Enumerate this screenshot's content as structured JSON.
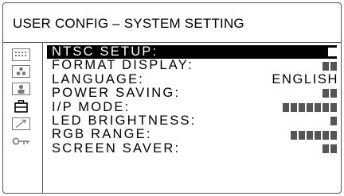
{
  "title": "USER CONFIG – SYSTEM SETTING",
  "sidebar": {
    "icons": [
      {
        "name": "dots-grid-icon"
      },
      {
        "name": "color-palette-icon"
      },
      {
        "name": "user-profile-icon"
      },
      {
        "name": "toolbox-icon",
        "active": true
      },
      {
        "name": "arrow-up-right-icon"
      },
      {
        "name": "key-icon"
      }
    ]
  },
  "menu": {
    "items": [
      {
        "label": "NTSC SETUP:",
        "value_type": "blocks",
        "blocks": 1,
        "selected": true
      },
      {
        "label": "FORMAT DISPLAY:",
        "value_type": "blocks",
        "blocks": 2
      },
      {
        "label": "LANGUAGE:",
        "value_type": "text",
        "value": "ENGLISH"
      },
      {
        "label": "POWER SAVING:",
        "value_type": "blocks",
        "blocks": 2
      },
      {
        "label": "I/P MODE:",
        "value_type": "blocks",
        "blocks": 7
      },
      {
        "label": "LED BRIGHTNESS:",
        "value_type": "blocks",
        "blocks": 1
      },
      {
        "label": "RGB RANGE:",
        "value_type": "blocks",
        "blocks": 6
      },
      {
        "label": "SCREEN SAVER:",
        "value_type": "blocks",
        "blocks": 2
      }
    ]
  },
  "colors": {
    "frame": "#555555",
    "selected_background": "#000000",
    "selected_text": "#ffffff",
    "block": "#555555"
  }
}
